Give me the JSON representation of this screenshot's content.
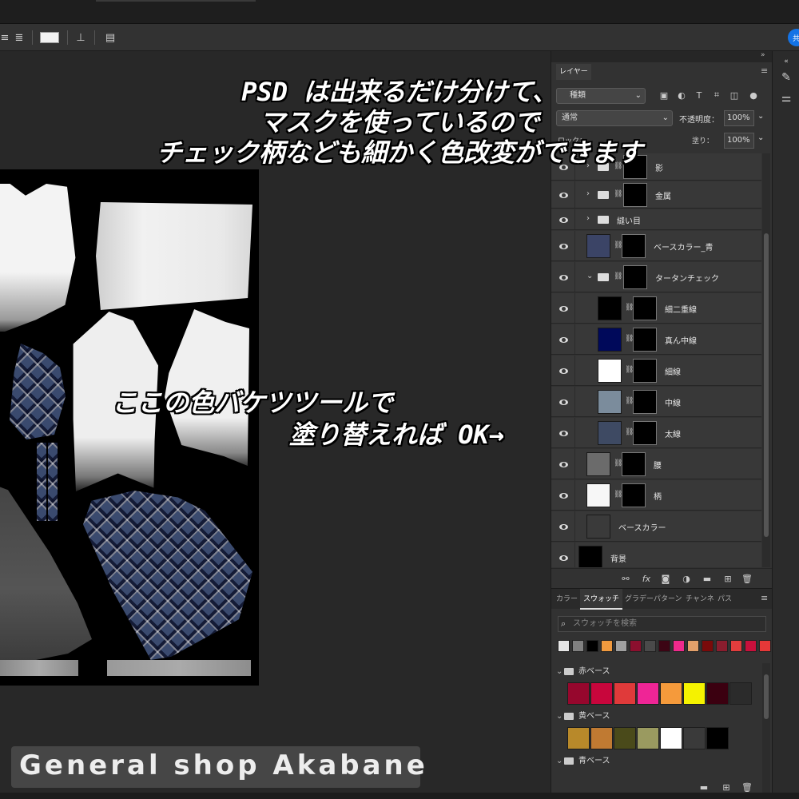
{
  "layers_panel": {
    "tab_label": "レイヤー",
    "filter_label": "種類",
    "blend_mode": "通常",
    "opacity_label": "不透明度：",
    "opacity_value": "100%",
    "lock_label": "ロック：",
    "fill_label": "塗り：",
    "fill_value": "100%",
    "layers": [
      {
        "name": "影",
        "type": "group",
        "visible": true
      },
      {
        "name": "金属",
        "type": "group",
        "visible": true
      },
      {
        "name": "縫い目",
        "type": "group",
        "visible": true
      },
      {
        "name": "ベースカラー_青",
        "type": "layer",
        "visible": true,
        "thumb_color": "#3b4466"
      },
      {
        "name": "タータンチェック",
        "type": "group",
        "visible": true
      },
      {
        "name": "細二重線",
        "type": "layer",
        "visible": true,
        "thumb_color": "#000000"
      },
      {
        "name": "真ん中線",
        "type": "layer",
        "visible": true,
        "thumb_color": "#00095a"
      },
      {
        "name": "細線",
        "type": "layer",
        "visible": true,
        "thumb_color": "#ffffff"
      },
      {
        "name": "中線",
        "type": "layer",
        "visible": true,
        "thumb_color": "#7b8c9c"
      },
      {
        "name": "太線",
        "type": "layer",
        "visible": true,
        "thumb_color": "#3e4a63"
      },
      {
        "name": "腰",
        "type": "layer",
        "visible": true,
        "thumb_color": "#6b6b6b"
      },
      {
        "name": "柄",
        "type": "layer",
        "visible": true,
        "thumb_color": "#f7f7f7"
      },
      {
        "name": "ベースカラー",
        "type": "layer",
        "visible": true,
        "thumb_color": "#3a3a3a"
      },
      {
        "name": "背景",
        "type": "layer",
        "visible": true,
        "thumb_color": "#000000"
      }
    ]
  },
  "swatches_panel": {
    "tabs": [
      "カラー",
      "スウォッチ",
      "グラデー",
      "パターン",
      "チャンネ",
      "パス"
    ],
    "active_tab": "スウォッチ",
    "search_placeholder": "スウォッチを検索",
    "recent": [
      "#e6e6e6",
      "#808080",
      "#000000",
      "#f19a3e",
      "#a0a0a0",
      "#8c0f2e",
      "#4a4a4a",
      "#3c0514",
      "#ee2a8c",
      "#e3a06a",
      "#7a0a0a",
      "#8a1d2e",
      "#e23d3d",
      "#c8103c",
      "#e63838"
    ],
    "groups": [
      {
        "name": "赤ベース",
        "colors": [
          "#96072d",
          "#c8063c",
          "#e03a3a",
          "#ef2596",
          "#f59a3b",
          "#f5f200",
          "#3b0010",
          "#2b2b2b"
        ]
      },
      {
        "name": "黄ベース",
        "colors": [
          "#b8892a",
          "#c07a32",
          "#4a4a1a",
          "#9a9a60",
          "#ffffff",
          "#3a3a3a",
          "#000000"
        ]
      },
      {
        "name": "青ベース",
        "colors": []
      }
    ]
  },
  "overlay_text": {
    "top_line1": "PSD は出来るだけ分けて、",
    "top_line2": "マスクを使っているので",
    "top_line3": "チェック柄なども細かく色改変ができます",
    "mid_line1": "ここの色バケツツールで",
    "mid_line2": "塗り替えれば OK→"
  },
  "brand": "General shop Akabane"
}
